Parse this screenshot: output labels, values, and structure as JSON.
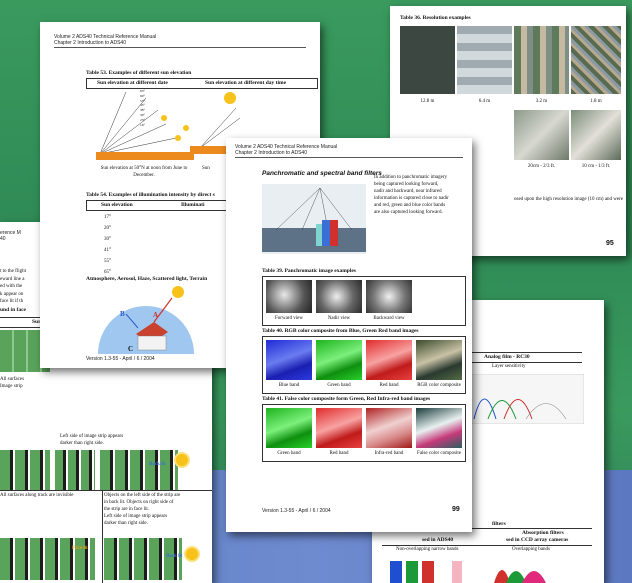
{
  "page1": {
    "header_line1": "Volume 2    ADS40 Technical Reference Manual",
    "header_line2": "Chapter 2    Introduction to ADS40",
    "table53_title": "Table 53. Examples of different sun elevation",
    "col_date": "Sun elevation at different date",
    "col_time": "Sun elevation at different day time",
    "elevations": [
      "63°",
      "60°",
      "53°",
      "45°",
      "38°",
      "30°",
      "23°",
      "16°"
    ],
    "elev_caption": "Sun elevation at 50°N at noon from June to December.",
    "elev_caption_short": "Sun",
    "table54_title": "Table 54. Examples of illumination intensity by direct s",
    "col_elev": "Sun elevation",
    "col_illum": "Illuminati",
    "elev_rows": [
      "17°",
      "20°",
      "30°",
      "41°",
      "55°",
      "65°"
    ],
    "atmos_title": "Atmosphere, Aerosol, Haze, Scattered light, Terrain",
    "diagram_labels": {
      "a": "A",
      "b": "B",
      "c": "C"
    },
    "footer": "Version 1.3-55 - April / 6 / 2004"
  },
  "page2": {
    "frag_lines": [
      "erence M",
      "40"
    ],
    "body_lines": [
      "t to the flight",
      "eward line a",
      "ed with the",
      "k appear on",
      "face lit if th"
    ],
    "title": "und in face",
    "col_sur": "Sur",
    "row1_left_lines": [
      "All surfaces",
      "Image strip"
    ],
    "row1_right_lines": [
      "Left side of image strip appears",
      "darker than right side."
    ],
    "row2_left": "All surfaces along track are invisible",
    "row2_right_lines": [
      "Objects on the left side of the strip are",
      "in back lit. Objects on right side of",
      "the strip are in face lit.",
      "Left side of image strip appears",
      "darker than right side."
    ],
    "back_lit": "Back lit",
    "face_lit": "Face lit"
  },
  "page3": {
    "title": "Table 36. Resolution examples",
    "resolutions": [
      "12.8 m",
      "6.4 m",
      "3.2 m",
      "1.8 m"
    ],
    "row2_labels": [
      "20cm - 2/3 ft.",
      "10 cm - 1/3 ft."
    ],
    "note": "osed upon the high resolution image (10 cm) and were",
    "page_num": "95"
  },
  "page4": {
    "header_line1": "Volume 2    ADS40 Technical Reference Manual",
    "header_line2": "Chapter 2    Introduction to ADS40",
    "section": "Panchromatic and spectral band filters",
    "intro_lines": [
      "In addition to panchromatic imagery",
      "being captured looking forward,",
      "nadir and backward, near infrared",
      "information is captured close to nadir",
      "and red, green and blue color bands",
      "are also captured looking forward."
    ],
    "t39": "Table 39. Panchromatic image examples",
    "t39_labels": [
      "Forward view",
      "Nadir view",
      "Backward view"
    ],
    "t40": "Table 40. RGB color composite from Blue, Green Red band images",
    "t40_labels": [
      "Blue band",
      "Green band",
      "Red band",
      "RGB color composite"
    ],
    "t41": "Table 41. False color composite form Green, Red Infra-red band images",
    "t41_labels": [
      "Green band",
      "Red band",
      "Infra-red band",
      "False color composite"
    ],
    "footer": "Version 1.3-55 - April / 6 / 2004",
    "page_num": "99"
  },
  "page5": {
    "frag": "tivity",
    "col": "Analog film - RC30",
    "sub": "Layer sensitivity",
    "lines": [
      "contain spectral ranges of light is",
      "",
      "ties show, the spectral sensitivity of",
      "itivity of the other two dyes in the",
      "essential for normal looking color or",
      "for remote sensing purposes",
      "ental and true color imagery are differ-",
      "w bands and an infrared channel.",
      "sensitivity and therefore require broad"
    ],
    "filters": "filters",
    "used": "sed in ADS40",
    "absorption": "Absorption filters",
    "ccd": "sed in CCD array cameras",
    "nonoverlap": "Non-overlapping narrow bands",
    "overlap": "Overlapping bands"
  }
}
